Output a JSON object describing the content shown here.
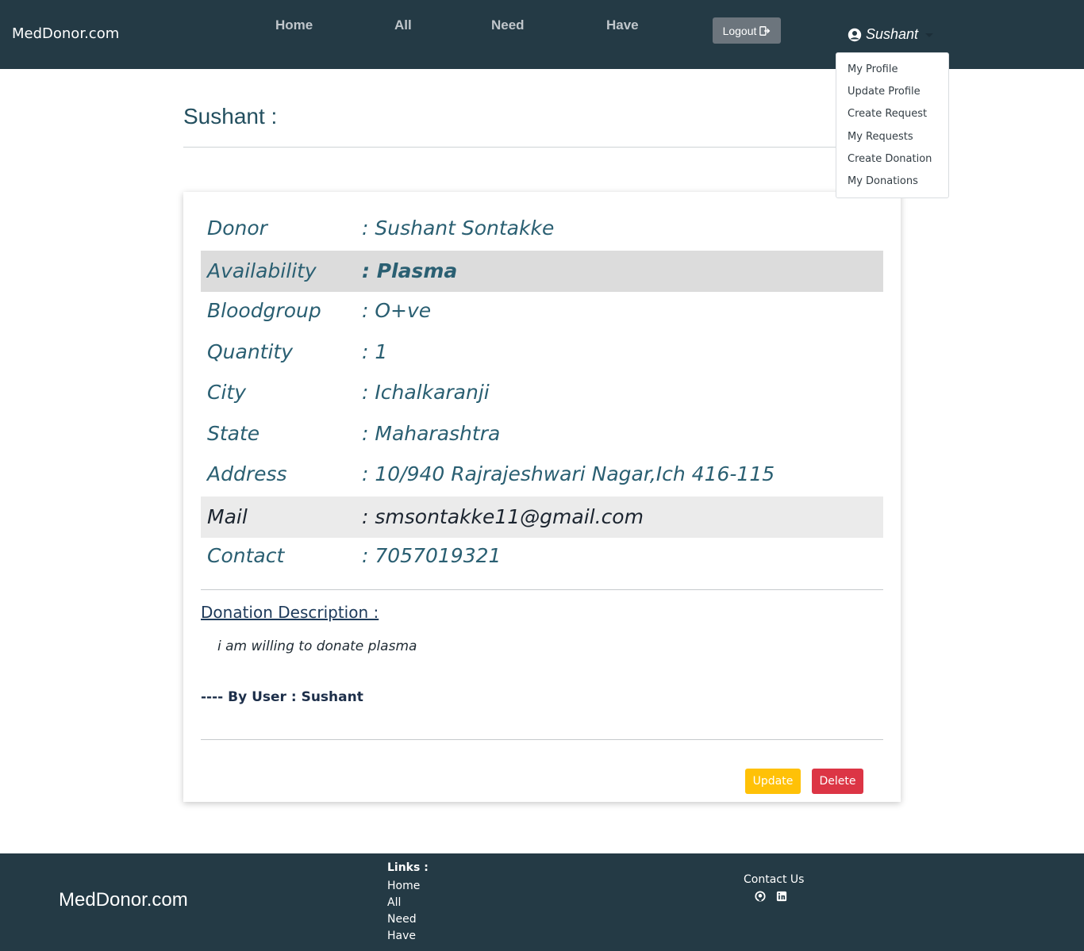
{
  "navbar": {
    "brand": "MedDonor.com",
    "links": [
      "Home",
      "All",
      "Need",
      "Have"
    ],
    "logout_label": "Logout",
    "user_name": "Sushant"
  },
  "dropdown": {
    "items": [
      "My Profile",
      "Update Profile",
      "Create Request",
      "My Requests",
      "Create Donation",
      "My Donations"
    ]
  },
  "page": {
    "title": "Sushant :"
  },
  "card": {
    "rows": [
      {
        "label": "Donor",
        "value": ": Sushant Sontakke"
      },
      {
        "label": "Availability",
        "value": ": Plasma"
      },
      {
        "label": "Bloodgroup",
        "value": ": O+ve"
      },
      {
        "label": "Quantity",
        "value": ": 1"
      },
      {
        "label": "City",
        "value": ": Ichalkaranji"
      },
      {
        "label": "State",
        "value": ": Maharashtra"
      },
      {
        "label": "Address",
        "value": ": 10/940 Rajrajeshwari Nagar,Ich 416-115"
      },
      {
        "label": "Mail",
        "value": ": smsontakke11@gmail.com"
      },
      {
        "label": "Contact",
        "value": ": 7057019321"
      }
    ],
    "description_title": "Donation Description :",
    "description_text": "i am willing to donate plasma",
    "by_user": "---- By User : Sushant",
    "update_label": "Update",
    "delete_label": "Delete"
  },
  "footer": {
    "brand": "MedDonor.com",
    "links_title": "Links :",
    "links": [
      "Home",
      "All",
      "Need",
      "Have"
    ],
    "contact_title": "Contact Us",
    "icons": [
      "github-icon",
      "linkedin-icon"
    ]
  },
  "colors": {
    "navbar_bg": "#243a45",
    "accent_text": "#2a5f72",
    "update_btn": "#ffc107",
    "delete_btn": "#dc3545",
    "logout_btn": "#6c757d"
  }
}
